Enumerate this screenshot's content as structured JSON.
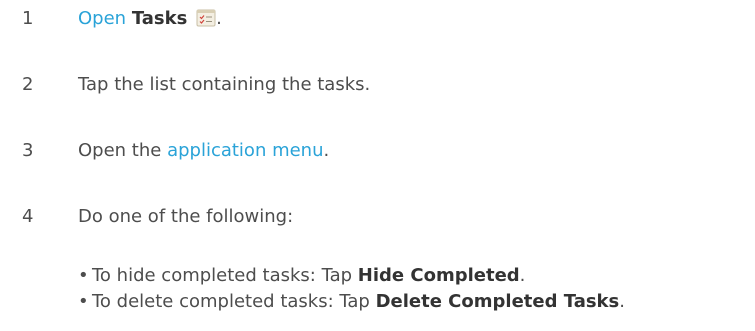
{
  "steps": [
    {
      "number": "1",
      "link": "Open",
      "ui": "Tasks",
      "after_icon": "."
    },
    {
      "number": "2",
      "text": "Tap the list containing the tasks."
    },
    {
      "number": "3",
      "text_before": "Open the ",
      "link": "application menu",
      "text_after": "."
    },
    {
      "number": "4",
      "text": "Do one of the following:"
    }
  ],
  "bullets": [
    {
      "bullet_char": "•",
      "text": "To hide completed tasks: Tap ",
      "ui": "Hide Completed",
      "after": "."
    },
    {
      "bullet_char": "•",
      "text": "To delete completed tasks: Tap ",
      "ui": "Delete Completed Tasks",
      "after": "."
    }
  ],
  "icons": {
    "tasks_icon": "tasks-app-icon"
  },
  "colors": {
    "text": "#4d4d4d",
    "link": "#2aa3d8",
    "ui_label": "#333333",
    "background": "#ffffff"
  }
}
